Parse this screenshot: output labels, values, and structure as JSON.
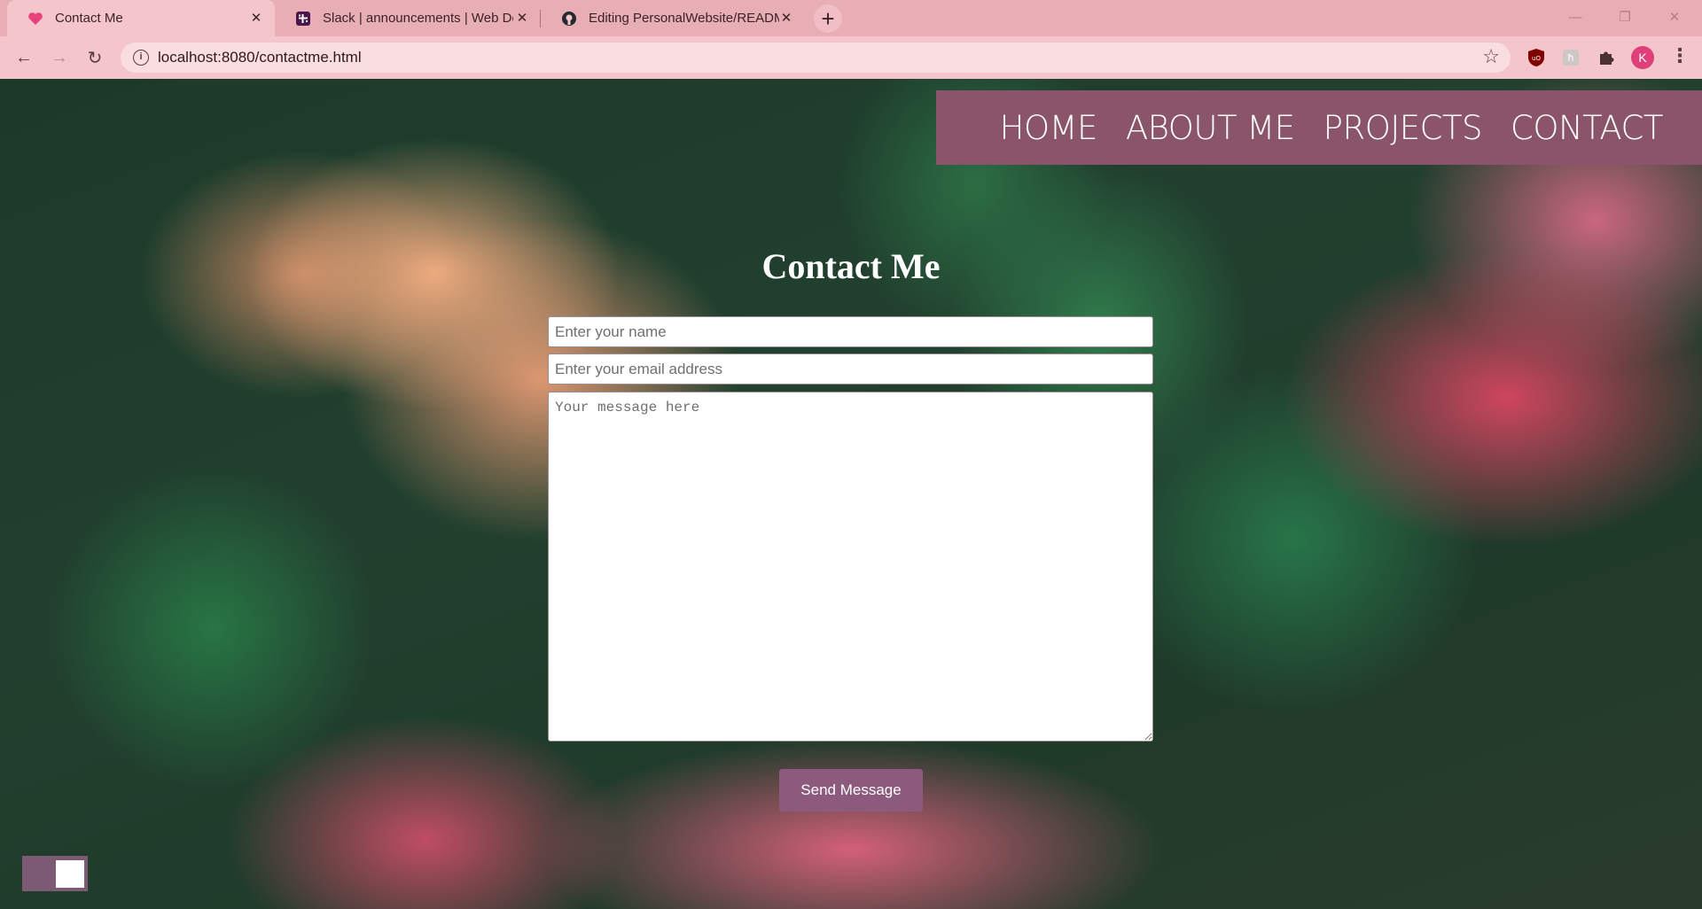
{
  "browser": {
    "tabs": [
      {
        "title": "Contact Me",
        "icon": "heart-icon",
        "active": true
      },
      {
        "title": "Slack | announcements | Web De",
        "icon": "slack-icon",
        "active": false
      },
      {
        "title": "Editing PersonalWebsite/READM",
        "icon": "github-icon",
        "active": false
      }
    ],
    "new_tab": "+",
    "url": "localhost:8080/contactme.html",
    "profile_initial": "K"
  },
  "nav": {
    "items": [
      "HOME",
      "ABOUT ME",
      "PROJECTS",
      "CONTACT"
    ]
  },
  "form": {
    "title": "Contact Me",
    "name_placeholder": "Enter your name",
    "email_placeholder": "Enter your email address",
    "message_placeholder": "Your message here",
    "submit_label": "Send Message"
  },
  "colors": {
    "nav_background": "#8b5569",
    "button_background": "#8b5a7c",
    "chrome_tabstrip": "#e8aeb5",
    "chrome_toolbar": "#f4c6cc"
  }
}
